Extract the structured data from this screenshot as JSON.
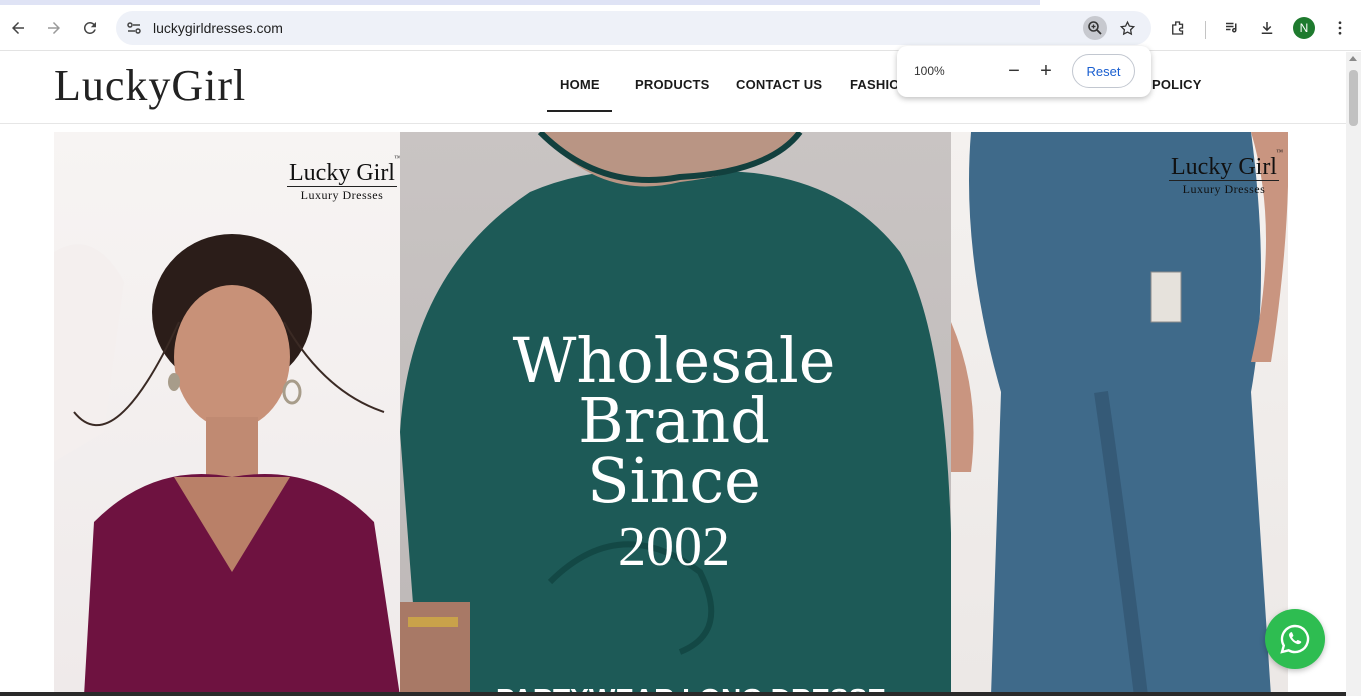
{
  "browser": {
    "url": "luckygirldresses.com",
    "profile_initial": "N",
    "zoom_popup": {
      "percent": "100%",
      "decrease": "−",
      "increase": "+",
      "reset_label": "Reset"
    }
  },
  "site": {
    "logo_text": "LuckyGirl",
    "nav": {
      "home": "HOME",
      "products": "PRODUCTS",
      "contact": "CONTACT US",
      "fashion": "FASHIO",
      "policy": "POLICY"
    }
  },
  "hero": {
    "mark_left": {
      "name": "Lucky Girl",
      "tm": "™",
      "sub": "Luxury Dresses"
    },
    "mark_right": {
      "name": "Lucky Girl",
      "tm": "™",
      "sub": "Luxury Dresses"
    },
    "headline": {
      "line1": "Wholesale",
      "line2": "Brand",
      "line3": "Since",
      "line4": "2002"
    },
    "bottom_banner": "PARTYWEAR LONG DRESSES"
  },
  "colors": {
    "left_dress": "#6e1240",
    "middle_dress": "#1d5a57",
    "right_dress": "#3f6a8a",
    "whatsapp": "#2ebd51"
  },
  "icons": [
    "back-icon",
    "forward-icon",
    "reload-icon",
    "site-info-icon",
    "zoom-icon",
    "star-icon",
    "extensions-icon",
    "reading-list-icon",
    "download-icon",
    "kebab-menu-icon",
    "whatsapp-icon"
  ]
}
